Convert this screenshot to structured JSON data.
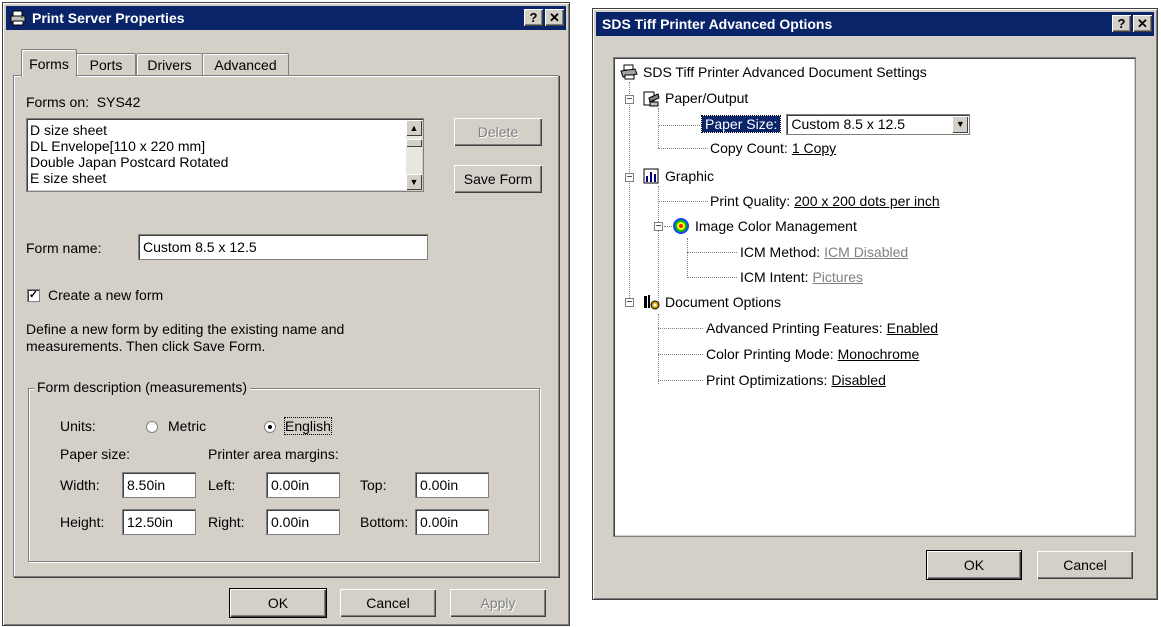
{
  "left_window": {
    "title": "Print Server Properties",
    "title_buttons": {
      "help": "?",
      "close": "✕"
    },
    "tabs": [
      "Forms",
      "Ports",
      "Drivers",
      "Advanced"
    ],
    "forms_on_label": "Forms on:",
    "forms_on_server": "SYS42",
    "forms_list": [
      "D size sheet",
      "DL Envelope[110 x 220 mm]",
      "Double Japan Postcard Rotated",
      "E size sheet"
    ],
    "delete_button": "Delete",
    "save_form_button": "Save Form",
    "form_name_label": "Form name:",
    "form_name_value": "Custom 8.5 x 12.5",
    "create_new_form_label": "Create a new form",
    "create_new_form_checked": true,
    "instructions_line1": "Define a new form by editing the existing name and",
    "instructions_line2": "measurements.  Then click Save Form.",
    "group_title": "Form description (measurements)",
    "units_label": "Units:",
    "metric_label": "Metric",
    "english_label": "English",
    "selected_unit": "English",
    "paper_size_label": "Paper size:",
    "printer_margins_label": "Printer area margins:",
    "width_label": "Width:",
    "width_value": "8.50in",
    "height_label": "Height:",
    "height_value": "12.50in",
    "left_label": "Left:",
    "left_value": "0.00in",
    "right_label": "Right:",
    "right_value": "0.00in",
    "top_label": "Top:",
    "top_value": "0.00in",
    "bottom_label": "Bottom:",
    "bottom_value": "0.00in",
    "ok_button": "OK",
    "cancel_button": "Cancel",
    "apply_button": "Apply"
  },
  "right_window": {
    "title": "SDS Tiff Printer Advanced Options",
    "title_buttons": {
      "help": "?",
      "close": "✕"
    },
    "root_label": "SDS Tiff Printer Advanced Document Settings",
    "paper_output_label": "Paper/Output",
    "paper_size_label": "Paper Size:",
    "paper_size_value": "Custom 8.5 x 12.5",
    "copy_count_label": "Copy Count:",
    "copy_count_value": "1 Copy",
    "graphic_label": "Graphic",
    "print_quality_label": "Print Quality:",
    "print_quality_value": "200 x 200 dots per inch",
    "icm_label": "Image Color Management",
    "icm_method_label": "ICM Method:",
    "icm_method_value": "ICM Disabled",
    "icm_intent_label": "ICM Intent:",
    "icm_intent_value": "Pictures",
    "doc_options_label": "Document Options",
    "adv_print_label": "Advanced Printing Features:",
    "adv_print_value": "Enabled",
    "color_mode_label": "Color Printing Mode:",
    "color_mode_value": "Monochrome",
    "print_opt_label": "Print Optimizations:",
    "print_opt_value": "Disabled",
    "ok_button": "OK",
    "cancel_button": "Cancel"
  }
}
